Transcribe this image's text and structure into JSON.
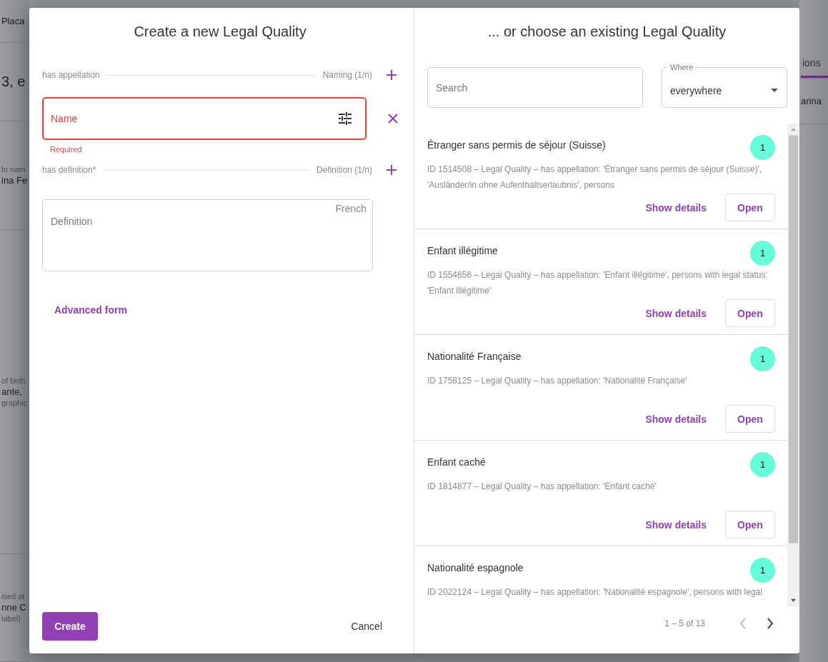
{
  "background": {
    "left": [
      {
        "kind": "value",
        "text": "Placa"
      },
      {
        "kind": "heading",
        "text": "3, e"
      },
      {
        "kind": "stack",
        "lines": [
          "to nam",
          "ina Fe"
        ]
      },
      {
        "kind": "stack",
        "lines": [
          "of birth",
          "ante,",
          "graphic"
        ]
      },
      {
        "kind": "stack",
        "lines": [
          "ised at",
          "nne C",
          "label)"
        ]
      }
    ],
    "right": [
      {
        "kind": "tab",
        "text": "ions"
      },
      {
        "kind": "value",
        "text": "arina"
      }
    ]
  },
  "create": {
    "title": "Create a new Legal Quality",
    "fields": [
      {
        "kind": "section",
        "label": "has appellation",
        "type": "Naming (1/n)"
      },
      {
        "kind": "input",
        "label": "Name",
        "invalid": true,
        "error": "Required"
      },
      {
        "kind": "section",
        "label": "has definition*",
        "type": "Definition (1/n)"
      },
      {
        "kind": "textarea",
        "placeholder": "Definition",
        "language": "French"
      }
    ],
    "advanced_link": "Advanced form",
    "buttons": {
      "primary": "Create",
      "secondary": "Cancel"
    }
  },
  "choose": {
    "title": "... or choose an existing Legal Quality",
    "search": {
      "placeholder": "Search"
    },
    "where": {
      "label": "Where",
      "value": "everywhere"
    },
    "results": [
      {
        "title": "Étranger sans permis de séjour (Suisse)",
        "description": "ID 1514508 – Legal Quality – has appellation: 'Étranger sans permis de séjour (Suisse)', 'Ausländer/in ohne Aufenthaltserlaubnis', persons",
        "count": "1",
        "details": "Show details",
        "open": "Open"
      },
      {
        "title": "Enfant illégitime",
        "description": "ID 1554656 – Legal Quality – has appellation: 'Enfant illégitime', persons with legal status: 'Enfant illégitime'",
        "count": "1",
        "details": "Show details",
        "open": "Open"
      },
      {
        "title": "Nationalité Française",
        "description": "ID 1758125 – Legal Quality – has appellation: 'Nationalité Française'",
        "count": "1",
        "details": "Show details",
        "open": "Open"
      },
      {
        "title": "Enfant caché",
        "description": "ID 1814877 – Legal Quality – has appellation: 'Enfant caché'",
        "count": "1",
        "details": "Show details",
        "open": "Open"
      },
      {
        "title": "Nationalité espagnole",
        "description": "ID 2022124 – Legal Quality – has appellation: 'Nationalité espagnole', persons with legal",
        "count": "1"
      }
    ],
    "pagination": {
      "range": "1 – 5 of 13",
      "prev_disabled": true,
      "next_disabled": false
    }
  }
}
